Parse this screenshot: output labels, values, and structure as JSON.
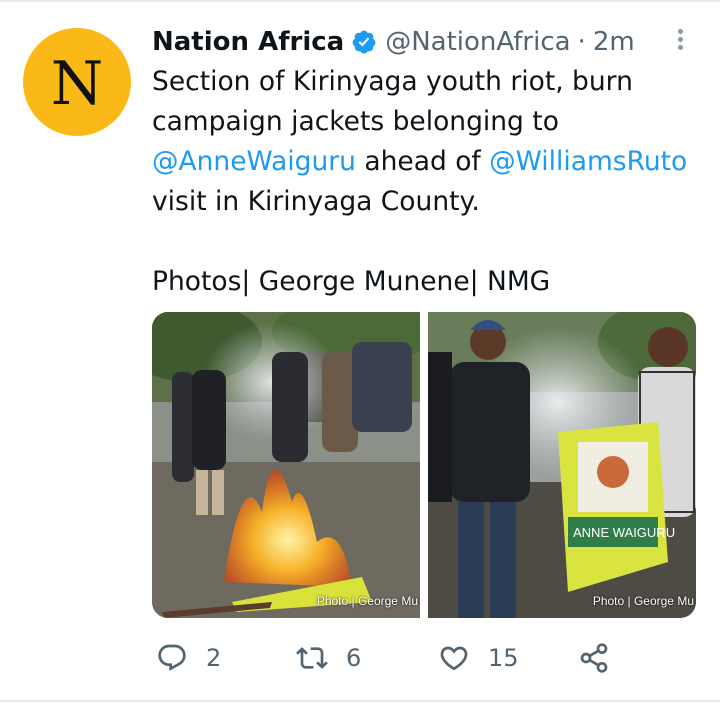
{
  "tweet": {
    "avatar_letter": "N",
    "author_name": "Nation Africa",
    "handle": "@NationAfrica",
    "separator": "·",
    "time": "2m",
    "text": {
      "line1": "Section of Kirinyaga youth riot, burn",
      "line2": "campaign jackets belonging to",
      "mention1": "@AnneWaiguru",
      "line3_mid": " ahead of ",
      "mention2": "@WilliamsRuto",
      "line4": "visit in Kirinyaga County.",
      "credit_line": "Photos| George Munene| NMG"
    },
    "photos": [
      {
        "credit": "Photo | George Mu"
      },
      {
        "credit": "Photo | George Mu"
      }
    ],
    "stats": {
      "replies": "2",
      "retweets": "6",
      "likes": "15"
    }
  },
  "colors": {
    "brand_yellow": "#fbb917",
    "link_blue": "#1d9bf0",
    "secondary_text": "#536471"
  },
  "icons": [
    "verified-badge-icon",
    "more-options-icon",
    "reply-icon",
    "retweet-icon",
    "like-icon",
    "share-icon"
  ]
}
